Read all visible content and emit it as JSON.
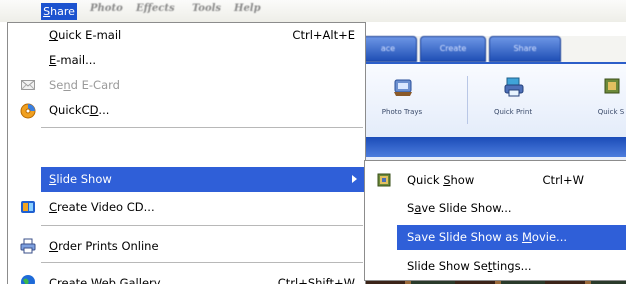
{
  "menubar": {
    "items": [
      {
        "label": "Share",
        "accel": "S",
        "rest": "hare"
      },
      {
        "label": "Photo"
      },
      {
        "label": "Effects"
      },
      {
        "label": "Tools"
      },
      {
        "label": "Help"
      }
    ]
  },
  "app": {
    "tabs": [
      "ace",
      "Create",
      "Share"
    ],
    "toolbar": [
      {
        "label": "Photo Trays",
        "icon": "photo-trays-icon"
      },
      {
        "label": "Quick Print",
        "icon": "quick-print-icon"
      },
      {
        "label": "Quick S",
        "icon": "quick-share-icon"
      }
    ]
  },
  "share_menu": {
    "items": [
      {
        "id": "quick-email",
        "pre": "",
        "accel": "Q",
        "post": "uick E-mail",
        "shortcut": "Ctrl+Alt+E",
        "icon": null
      },
      {
        "id": "email",
        "pre": "",
        "accel": "E",
        "post": "-mail...",
        "shortcut": "",
        "icon": null
      },
      {
        "id": "send-ecard",
        "pre": "Se",
        "accel": "n",
        "post": "d E-Card",
        "shortcut": "",
        "icon": "envelope-icon",
        "disabled": true
      },
      {
        "id": "quickcd",
        "pre": "QuickC",
        "accel": "D",
        "post": "...",
        "shortcut": "",
        "icon": "cd-icon"
      },
      {
        "id": "slide-show",
        "pre": "",
        "accel": "S",
        "post": "lide Show",
        "shortcut": "",
        "icon": null,
        "submenu": true,
        "active": true
      },
      {
        "id": "create-video-cd",
        "pre": "",
        "accel": "C",
        "post": "reate Video CD...",
        "shortcut": "",
        "icon": "video-cd-icon"
      },
      {
        "id": "order-prints",
        "pre": "",
        "accel": "O",
        "post": "rder Prints Online",
        "shortcut": "",
        "icon": "printer-icon"
      },
      {
        "id": "create-web-gallery",
        "pre": "Create Web Gallery",
        "accel": "",
        "post": "",
        "shortcut": "Ctrl+Shift+W",
        "icon": "globe-icon"
      }
    ]
  },
  "slide_submenu": {
    "items": [
      {
        "id": "quick-show",
        "pre": "Quick ",
        "accel": "S",
        "post": "how",
        "shortcut": "Ctrl+W",
        "icon": "slideshow-icon"
      },
      {
        "id": "save-slide-show",
        "pre": "S",
        "accel": "a",
        "post": "ve Slide Show...",
        "shortcut": ""
      },
      {
        "id": "save-as-movie",
        "pre": "Save Slide Show as ",
        "accel": "M",
        "post": "ovie...",
        "shortcut": "",
        "active": true
      },
      {
        "id": "slide-show-settings",
        "pre": "Slide Show Se",
        "accel": "t",
        "post": "tings...",
        "shortcut": ""
      }
    ]
  }
}
